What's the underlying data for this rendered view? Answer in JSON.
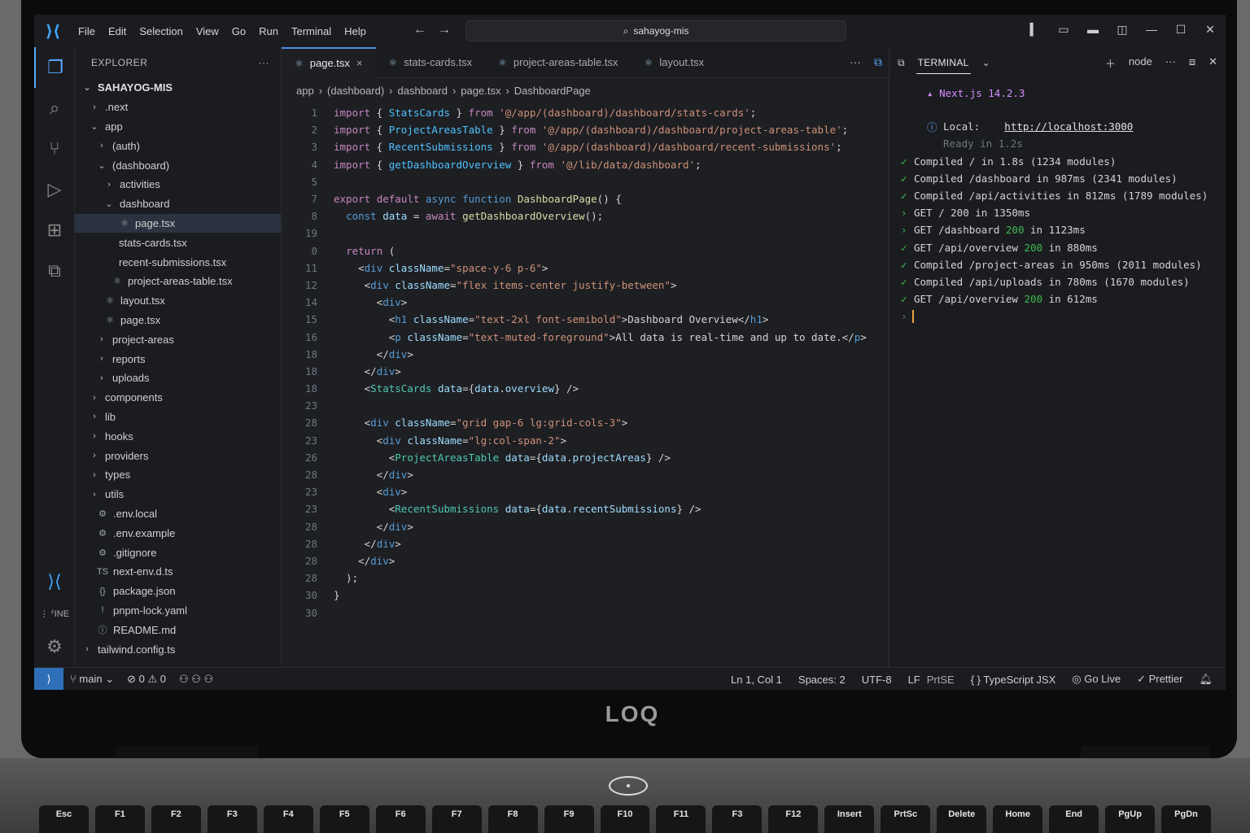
{
  "window": {
    "menu": [
      "File",
      "Edit",
      "Selection",
      "View",
      "Go",
      "Run",
      "Terminal",
      "Help"
    ],
    "command_center": "sahayog-mis"
  },
  "sidebar": {
    "header": "EXPLORER",
    "more": "···",
    "items": [
      {
        "label": "SAHAYOG-MIS",
        "depth": 0,
        "chev": "⌄",
        "icon": "",
        "root": true
      },
      {
        "label": ".next",
        "depth": 1,
        "chev": "›",
        "icon": ""
      },
      {
        "label": "app",
        "depth": 1,
        "chev": "⌄",
        "icon": ""
      },
      {
        "label": "(auth)",
        "depth": 2,
        "chev": "›",
        "icon": ""
      },
      {
        "label": "(dashboard)",
        "depth": 2,
        "chev": "⌄",
        "icon": ""
      },
      {
        "label": "activities",
        "depth": 3,
        "chev": "›",
        "icon": ""
      },
      {
        "label": "dashboard",
        "depth": 3,
        "chev": "⌄",
        "icon": ""
      },
      {
        "label": "page.tsx",
        "depth": 4,
        "chev": "",
        "icon": "⚛",
        "selected": true
      },
      {
        "label": "stats-cards.tsx",
        "depth": 4,
        "chev": "",
        "icon": ""
      },
      {
        "label": "recent-submissions.tsx",
        "depth": 4,
        "chev": "",
        "icon": ""
      },
      {
        "label": "project-areas-table.tsx",
        "depth": 3,
        "chev": "",
        "icon": "⚛"
      },
      {
        "label": "layout.tsx",
        "depth": 2,
        "chev": "",
        "icon": "⚛"
      },
      {
        "label": "page.tsx",
        "depth": 2,
        "chev": "",
        "icon": "⚛"
      },
      {
        "label": "project-areas",
        "depth": 2,
        "chev": "›",
        "icon": ""
      },
      {
        "label": "reports",
        "depth": 2,
        "chev": "›",
        "icon": ""
      },
      {
        "label": "uploads",
        "depth": 2,
        "chev": "›",
        "icon": ""
      },
      {
        "label": "components",
        "depth": 1,
        "chev": "›",
        "icon": ""
      },
      {
        "label": "lib",
        "depth": 1,
        "chev": "›",
        "icon": ""
      },
      {
        "label": "hooks",
        "depth": 1,
        "chev": "›",
        "icon": ""
      },
      {
        "label": "providers",
        "depth": 1,
        "chev": "›",
        "icon": ""
      },
      {
        "label": "types",
        "depth": 1,
        "chev": "›",
        "icon": ""
      },
      {
        "label": "utils",
        "depth": 1,
        "chev": "›",
        "icon": ""
      },
      {
        "label": ".env.local",
        "depth": 1,
        "chev": "",
        "icon": "⚙"
      },
      {
        "label": ".env.example",
        "depth": 1,
        "chev": "",
        "icon": "⚙"
      },
      {
        "label": ".gitignore",
        "depth": 1,
        "chev": "",
        "icon": "⚙"
      },
      {
        "label": "next-env.d.ts",
        "depth": 1,
        "chev": "",
        "icon": "TS"
      },
      {
        "label": "package.json",
        "depth": 1,
        "chev": "",
        "icon": "{}"
      },
      {
        "label": "pnpm-lock.yaml",
        "depth": 1,
        "chev": "",
        "icon": "!"
      },
      {
        "label": "README.md",
        "depth": 1,
        "chev": "",
        "icon": "ⓘ"
      },
      {
        "label": "tailwind.config.ts",
        "depth": 0,
        "chev": "›",
        "icon": ""
      }
    ]
  },
  "editor": {
    "tabs": [
      {
        "label": "page.tsx",
        "active": true,
        "close": "×"
      },
      {
        "label": "stats-cards.tsx",
        "active": false,
        "close": ""
      },
      {
        "label": "project-areas-table.tsx",
        "active": false,
        "close": ""
      },
      {
        "label": "layout.tsx",
        "active": false,
        "close": ""
      }
    ],
    "breadcrumb": [
      "app",
      "(dashboard)",
      "dashboard",
      "page.tsx",
      "DashboardPage"
    ],
    "lines": [
      {
        "n": "1",
        "html": "<span class='kw2'>import</span> { <span class='id'>StatsCards</span> } <span class='kw2'>from</span> <span class='str'>'@/app/(dashboard)/dashboard/stats-cards'</span>;"
      },
      {
        "n": "2",
        "html": "<span class='kw2'>import</span> { <span class='id'>ProjectAreasTable</span> } <span class='kw2'>from</span> <span class='str'>'@/app/(dashboard)/dashboard/project-areas-table'</span>;"
      },
      {
        "n": "3",
        "html": "<span class='kw2'>import</span> { <span class='id'>RecentSubmissions</span> } <span class='kw2'>from</span> <span class='str'>'@/app/(dashboard)/dashboard/recent-submissions'</span>;"
      },
      {
        "n": "4",
        "html": "<span class='kw2'>import</span> { <span class='id'>getDashboardOverview</span> } <span class='kw2'>from</span> <span class='str'>'@/lib/data/dashboard'</span>;"
      },
      {
        "n": "5",
        "html": ""
      },
      {
        "n": "7",
        "html": "<span class='kw2'>export</span> <span class='kw2'>default</span> <span class='kw'>async</span> <span class='kw'>function</span> <span class='fn'>DashboardPage</span>() {"
      },
      {
        "n": "8",
        "html": "  <span class='kw'>const</span> <span class='attr'>data</span> = <span class='kw2'>await</span> <span class='fn'>getDashboardOverview</span>();"
      },
      {
        "n": "19",
        "html": ""
      },
      {
        "n": "0",
        "html": "  <span class='kw2'>return</span> ("
      },
      {
        "n": "11",
        "html": "    &lt;<span class='kw'>div</span> <span class='attr'>className</span>=<span class='str'>\"space-y-6 p-6\"</span>&gt;"
      },
      {
        "n": "12",
        "html": "     &lt;<span class='kw'>div</span> <span class='attr'>className</span>=<span class='str'>\"flex items-center justify-between\"</span>&gt;"
      },
      {
        "n": "14",
        "html": "       &lt;<span class='kw'>div</span>&gt;"
      },
      {
        "n": "15",
        "html": "         &lt;<span class='kw'>h1</span> <span class='attr'>className</span>=<span class='str'>\"text-2xl font-semibold\"</span>&gt;Dashboard Overview&lt;/<span class='kw'>h1</span>&gt;"
      },
      {
        "n": "16",
        "html": "         &lt;<span class='kw'>p</span> <span class='attr'>className</span>=<span class='str'>\"text-muted-foreground\"</span>&gt;All data is real-time and up to date.&lt;/<span class='kw'>p</span>&gt;"
      },
      {
        "n": "18",
        "html": "       &lt;/<span class='kw'>div</span>&gt;"
      },
      {
        "n": "18",
        "html": "     &lt;/<span class='kw'>div</span>&gt;"
      },
      {
        "n": "18",
        "html": "     &lt;<span class='cmp'>StatsCards</span> <span class='attr'>data</span>={<span class='attr'>data</span>.<span class='attr'>overview</span>} /&gt;"
      },
      {
        "n": "23",
        "html": ""
      },
      {
        "n": "28",
        "html": "     &lt;<span class='kw'>div</span> <span class='attr'>className</span>=<span class='str'>\"grid gap-6 lg:grid-cols-3\"</span>&gt;"
      },
      {
        "n": "23",
        "html": "       &lt;<span class='kw'>div</span> <span class='attr'>className</span>=<span class='str'>\"lg:col-span-2\"</span>&gt;"
      },
      {
        "n": "26",
        "html": "         &lt;<span class='cmp'>ProjectAreasTable</span> <span class='attr'>data</span>={<span class='attr'>data</span>.<span class='attr'>projectAreas</span>} /&gt;"
      },
      {
        "n": "28",
        "html": "       &lt;/<span class='kw'>div</span>&gt;"
      },
      {
        "n": "23",
        "html": "       &lt;<span class='kw'>div</span>&gt;"
      },
      {
        "n": "23",
        "html": "         &lt;<span class='cmp'>RecentSubmissions</span> <span class='attr'>data</span>={<span class='attr'>data</span>.<span class='attr'>recentSubmissions</span>} /&gt;"
      },
      {
        "n": "28",
        "html": "       &lt;/<span class='kw'>div</span>&gt;"
      },
      {
        "n": "28",
        "html": "     &lt;/<span class='kw'>div</span>&gt;"
      },
      {
        "n": "28",
        "html": "    &lt;/<span class='kw'>div</span>&gt;"
      },
      {
        "n": "28",
        "html": "  );"
      },
      {
        "n": "30",
        "html": "}"
      },
      {
        "n": "30",
        "html": ""
      }
    ]
  },
  "terminal": {
    "tab": "TERMINAL",
    "shell": "node",
    "next_version": "Next.js 14.2.3",
    "local_label": "Local:",
    "local_url": "http://localhost:3000",
    "ready": "Ready in 1.2s",
    "logs": [
      {
        "mark": "✓",
        "text": "Compiled / in 1.8s (1234 modules)",
        "status": ""
      },
      {
        "mark": "✓",
        "text": "Compiled /dashboard in 987ms (2341 modules)",
        "status": ""
      },
      {
        "mark": "✓",
        "text": "Compiled /api/activities in 812ms (1789 modules)",
        "status": ""
      },
      {
        "mark": "›",
        "text": "GET / 200 in 1350ms",
        "status": ""
      },
      {
        "mark": "›",
        "text": "GET /dashboard ",
        "status": "200",
        "tail": " in 1123ms"
      },
      {
        "mark": "✓",
        "text": "GET /api/overview ",
        "status": "200",
        "tail": " in 880ms"
      },
      {
        "mark": "✓",
        "text": "Compiled /project-areas in 950ms (2011 modules)",
        "status": ""
      },
      {
        "mark": "✓",
        "text": "Compiled /api/uploads in 780ms (1670 modules)",
        "status": ""
      },
      {
        "mark": "✓",
        "text": "GET /api/overview ",
        "status": "200",
        "tail": " in 612ms"
      }
    ],
    "prompt": "›"
  },
  "statusbar": {
    "branch": "main",
    "errors": "0",
    "warnings": "0",
    "position": "Ln 1, Col 1",
    "spaces": "Spaces: 2",
    "encoding": "UTF-8",
    "eol": "LF",
    "prtsc": "PrtSE",
    "language": "TypeScript JSX",
    "golive": "Go Live",
    "prettier": "Prettier"
  },
  "device": {
    "brand": "LOQ",
    "keys": [
      "Esc",
      "F1",
      "F2",
      "F3",
      "F4",
      "F5",
      "F6",
      "F7",
      "F8",
      "F9",
      "F10",
      "F11",
      "F3",
      "F12",
      "Insert",
      "PrtSc",
      "Delete",
      "Home",
      "End",
      "PgUp",
      "PgDn"
    ]
  }
}
